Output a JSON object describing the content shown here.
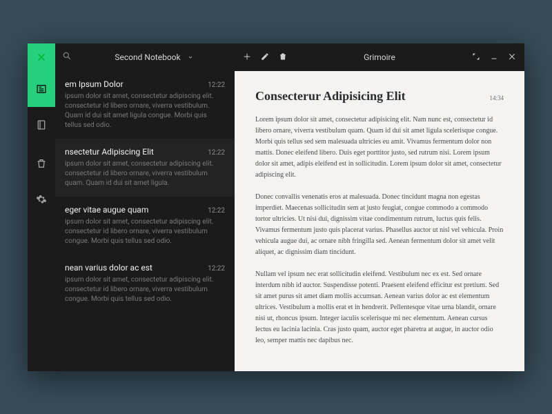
{
  "app": {
    "notebook_name": "Second Notebook",
    "document_title": "Grimoire"
  },
  "notes": [
    {
      "title": "em Ipsum Dolor",
      "time": "12:22",
      "excerpt": "ipsum dolor sit amet, consectetur adipiscing elit. consectetur id libero ornare, viverra vestibulum. Quam id dui sit amet ligula congue. Morbi quis tellus sed odio."
    },
    {
      "title": "nsectetur Adipiscing Elit",
      "time": "12:22",
      "excerpt": "ipsum dolor sit amet, consectetur adipiscing elit. consectetur id libero ornare, viverra vestibulum quam. Quam id dui sit amet ligula."
    },
    {
      "title": "eger vitae augue quam",
      "time": "12:22",
      "excerpt": "ipsum dolor sit amet, consectetur adipiscing elit. consectetur id libero ornare, viverra vestibulum congue. Morbi quis tellus sed odio."
    },
    {
      "title": "nean varius dolor ac est",
      "time": "12:22",
      "excerpt": "ipsum dolor sit amet, consectetur adipiscing elit. consectetur id libero ornare, viverra vestibulum congue. Morbi quis tellus sed odio."
    }
  ],
  "editor": {
    "title": "Consecterur Adipisicing Elit",
    "time": "14:34",
    "paragraphs": [
      "Lorem ipsum dolor sit amet, consectetur adipisicing elit. Nam nunc est, consectetur id libero ornare, viverra vestibulum quam. Quam id dui sit amet ligula scelerisque congue. Morbi quis tellus sed sem malesuada ultricies eu amit. Vivamus fermentum dolor non mattis. Donec eleifend libero. Duis eget porttitor justo, sed rutrum nisi. Lorem ipsum dolor sit amet, adipis eleifend est in sollicitudin. Lorem ipsum dolor sit amet, consectetur adipiscing elit.",
      "Donec convallis venenatis eros at malesuada. Donec tincidunt magna non egestas imperdiet. Maecenas sollicitudin sem at justo feugiat, congue commodo a commodo tortor ultricies. Ut nisi dui, dignissim vitae condimentum rutrum, luctus quis felis. Vivamus fermentum justo quis placerat varius. Phasellus auctor ut nisl vel vehicula. Proin vehicula augue dui, ac ornare nibh fringilla sed. Aenean fermentum dolor sit amet velit aliquet, ac dignissim diam tincidunt.",
      "Nullam vel ipsum nec erat sollicitudin eleifend. Vestibulum nec ex est. Sed ornare interdum nibh id auctor. Suspendisse potenti. Praesent eleifend efficitur est pretium. Sed sit amet purus sit amet diam mollis accumsan. Aenean varius dolor ac est elementum ultrices. Vestibulum a mollis erat et in hendrerit. Pellentesque vitae urna blandit, ornare nisi ut, rhoncus ipsum. Integer iaculis scelerisque mi nec elementum. Aenean cursus lectus eu lacinia lacinia. Cras justo quam, auctor eget pharetra at augue, in auctor odio leo, semper mattis nec dapibus nec."
    ]
  }
}
